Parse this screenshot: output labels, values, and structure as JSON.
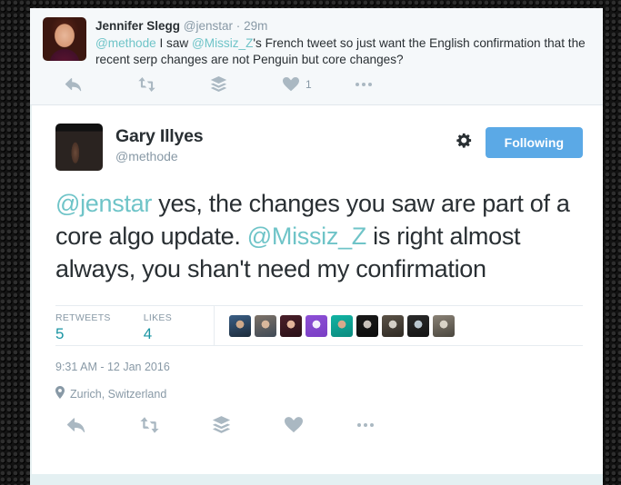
{
  "colors": {
    "accent_blue": "#5ba9e6",
    "link_teal": "#6fc4c8",
    "stat_teal": "#1b95a3",
    "text_dark": "#292f33",
    "text_muted": "#8899a6",
    "icon_grey": "#aab8c2",
    "parent_bg": "#f5f8fa",
    "card_bg": "#ffffff",
    "page_bg": "#121212",
    "bottom_strip": "#e4f0f2"
  },
  "parent_tweet": {
    "avatar_name": "jennifer-slegg-avatar",
    "display_name": "Jennifer Slegg",
    "handle": "@jenstar",
    "separator": "·",
    "time": "29m",
    "text_parts": [
      {
        "type": "mention",
        "text": "@methode"
      },
      {
        "type": "plain",
        "text": " I saw "
      },
      {
        "type": "mention",
        "text": "@Missiz_Z"
      },
      {
        "type": "plain",
        "text": "'s French tweet so just want the English confirmation that the recent serp changes are not Penguin but core changes?"
      }
    ],
    "actions": [
      {
        "icon": "reply-icon",
        "label": "Reply",
        "count": ""
      },
      {
        "icon": "retweet-icon",
        "label": "Retweet",
        "count": ""
      },
      {
        "icon": "buffer-icon",
        "label": "Buffer",
        "count": ""
      },
      {
        "icon": "like-icon",
        "label": "Like",
        "count": "1"
      },
      {
        "icon": "more-icon",
        "label": "More",
        "count": ""
      }
    ]
  },
  "main_tweet": {
    "avatar_name": "gary-illyes-avatar",
    "display_name": "Gary Illyes",
    "handle": "@methode",
    "gear_icon": "gear-icon",
    "follow_button": "Following",
    "text_parts": [
      {
        "type": "mention",
        "text": "@jenstar"
      },
      {
        "type": "plain",
        "text": " yes, the changes you saw are part of a core algo update. "
      },
      {
        "type": "mention",
        "text": "@Missiz_Z"
      },
      {
        "type": "plain",
        "text": " is right almost always, you shan't need my confirmation"
      }
    ],
    "stats": [
      {
        "label": "RETWEETS",
        "value": "5"
      },
      {
        "label": "LIKES",
        "value": "4"
      }
    ],
    "facepile": [
      {
        "name": "facepile-avatar-1",
        "colors": [
          "#3b5f86",
          "#cfa98a",
          "#1d2b3a"
        ]
      },
      {
        "name": "facepile-avatar-2",
        "colors": [
          "#7d7268",
          "#d8b79c",
          "#3f4a56"
        ]
      },
      {
        "name": "facepile-avatar-3",
        "colors": [
          "#4a1f2a",
          "#e3b49a",
          "#2a1017"
        ]
      },
      {
        "name": "facepile-avatar-4",
        "colors": [
          "#8d4fd6",
          "#f3eefb",
          "#7a3fc4"
        ]
      },
      {
        "name": "facepile-avatar-5",
        "colors": [
          "#11b3a3",
          "#d8a98c",
          "#0c8b7f"
        ]
      },
      {
        "name": "facepile-avatar-6",
        "colors": [
          "#1a1a1a",
          "#c9c2bb",
          "#0d0d0d"
        ]
      },
      {
        "name": "facepile-avatar-7",
        "colors": [
          "#5b5247",
          "#d4cfc6",
          "#2f2a24"
        ]
      },
      {
        "name": "facepile-avatar-8",
        "colors": [
          "#2b2b2b",
          "#b9c6cf",
          "#141414"
        ]
      },
      {
        "name": "facepile-avatar-9",
        "colors": [
          "#8a8276",
          "#d9d3c7",
          "#4a463e"
        ]
      }
    ],
    "timestamp": "9:31 AM - 12 Jan 2016",
    "location_icon": "location-pin-icon",
    "location": "Zurich, Switzerland",
    "actions": [
      {
        "icon": "reply-icon",
        "label": "Reply",
        "count": ""
      },
      {
        "icon": "retweet-icon",
        "label": "Retweet",
        "count": ""
      },
      {
        "icon": "buffer-icon",
        "label": "Buffer",
        "count": ""
      },
      {
        "icon": "like-icon",
        "label": "Like",
        "count": ""
      },
      {
        "icon": "more-icon",
        "label": "More",
        "count": ""
      }
    ]
  }
}
